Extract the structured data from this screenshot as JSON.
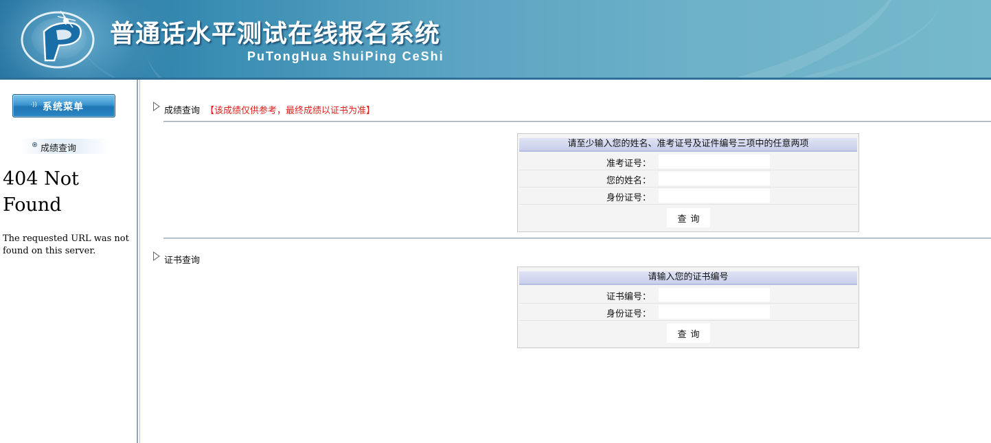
{
  "header": {
    "title": "普通话水平测试在线报名系统",
    "subtitle": "PuTongHua ShuiPing CeShi",
    "logo_icon": "putonghua-logo-icon"
  },
  "sidebar": {
    "menu_button_label": "系统菜单",
    "menu_button_icon": "sound-wave-icon",
    "items": [
      {
        "label": "成绩查询",
        "icon": "bullet-circle-icon"
      }
    ],
    "error": {
      "title": "404 Not Found",
      "message": "The requested URL was not found on this server."
    }
  },
  "main": {
    "score_section": {
      "title": "成绩查询",
      "note": "【该成绩仅供参考，最终成绩以证书为准】",
      "note_color": "#e0201c",
      "form": {
        "heading": "请至少输入您的姓名、准考证号及证件编号三项中的任意两项",
        "fields": [
          {
            "label": "准考证号：",
            "value": ""
          },
          {
            "label": "您的姓名：",
            "value": ""
          },
          {
            "label": "身份证号：",
            "value": ""
          }
        ],
        "submit_label": "查询"
      }
    },
    "certificate_section": {
      "title": "证书查询",
      "form": {
        "heading": "请输入您的证书编号",
        "fields": [
          {
            "label": "证书编号：",
            "value": ""
          },
          {
            "label": "身份证号：",
            "value": ""
          }
        ],
        "submit_label": "查询"
      }
    }
  },
  "colors": {
    "banner": "#3a8db3",
    "menu_button": "#2b86c3",
    "form_header": "#c9cfec",
    "alert": "#e0201c"
  }
}
